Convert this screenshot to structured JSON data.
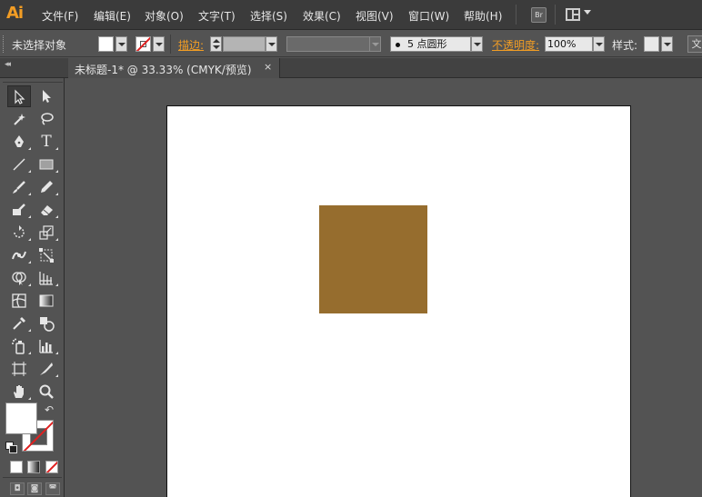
{
  "app": {
    "logo": "Ai",
    "accent": "#f29d24"
  },
  "menu": {
    "items": [
      "文件(F)",
      "编辑(E)",
      "对象(O)",
      "文字(T)",
      "选择(S)",
      "效果(C)",
      "视图(V)",
      "窗口(W)",
      "帮助(H)"
    ],
    "bridge_label": "Br"
  },
  "control_bar": {
    "selection_status": "未选择对象",
    "stroke_label": "描边:",
    "brush_size": "5",
    "brush_name": "点圆形",
    "opacity_label": "不透明度:",
    "opacity_value": "100%",
    "style_label": "样式:",
    "edge_button": "文"
  },
  "document_tab": {
    "title": "未标题-1* @ 33.33% (CMYK/预览)",
    "close_glyph": "×"
  },
  "tools": {
    "list": [
      "selection-tool",
      "direct-selection-tool",
      "magic-wand-tool",
      "lasso-tool",
      "pen-tool",
      "type-tool",
      "line-segment-tool",
      "rectangle-tool",
      "paintbrush-tool",
      "pencil-tool",
      "blob-brush-tool",
      "eraser-tool",
      "rotate-tool",
      "scale-tool",
      "width-tool",
      "free-transform-tool",
      "shape-builder-tool",
      "perspective-grid-tool",
      "mesh-tool",
      "gradient-tool",
      "eyedropper-tool",
      "blend-tool",
      "symbol-sprayer-tool",
      "column-graph-tool",
      "artboard-tool",
      "slice-tool",
      "hand-tool",
      "zoom-tool"
    ],
    "active": "selection-tool"
  },
  "colors": {
    "fill": "#ffffff",
    "stroke": "none",
    "square_fill": "#966d2e",
    "artboard": "#ffffff",
    "pasteboard": "#535353"
  }
}
